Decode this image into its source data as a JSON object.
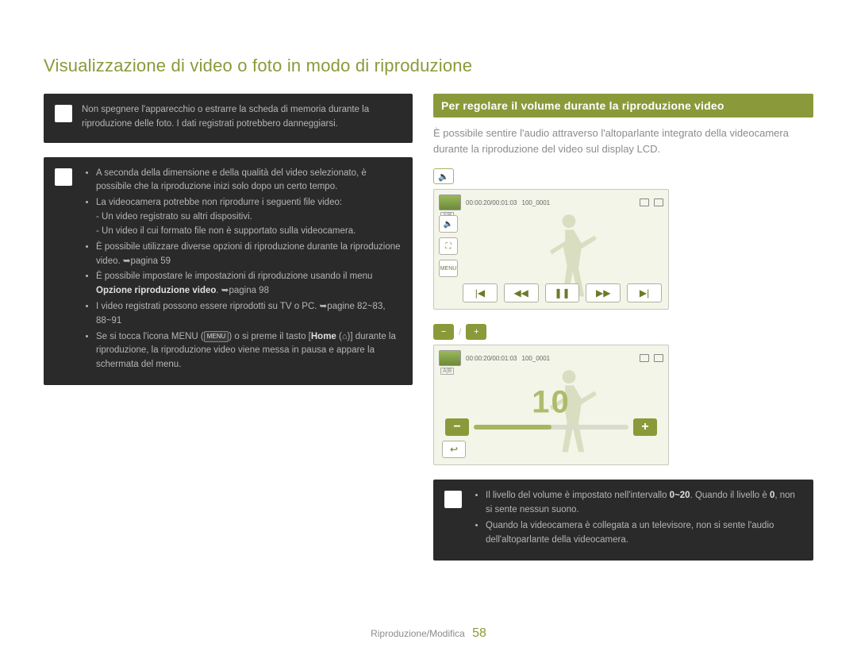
{
  "title": "Visualizzazione di video o foto in modo di riproduzione",
  "left": {
    "warn": "Non spegnere l'apparecchio o estrarre la scheda di memoria durante la riproduzione delle foto. I dati registrati potrebbero danneggiarsi.",
    "notes": {
      "i1": "A seconda della dimensione e della qualità del video selezionato, è possibile che la riproduzione inizi solo dopo un certo tempo.",
      "i2": "La videocamera potrebbe non riprodurre i seguenti file video:",
      "i2a": "- Un video registrato su altri dispositivi.",
      "i2b": "- Un video il cui formato file non è supportato sulla videocamera.",
      "i3": "È possibile utilizzare diverse opzioni di riproduzione durante la riproduzione video. ➥pagina 59",
      "i4a": "È possibile impostare le impostazioni di riproduzione usando il menu ",
      "i4b": "Opzione riproduzione video",
      "i4c": ". ➥pagina 98",
      "i5": "I video registrati possono essere riprodotti su TV o PC. ➥pagine 82~83, 88~91",
      "i6a": "Se si tocca l'icona MENU (",
      "i6b": ") o si preme il tasto [",
      "i6c": "Home",
      "i6d": " (",
      "i6e": ")] durante la riproduzione, la riproduzione video viene messa in pausa e appare la schermata del menu.",
      "menu_chip": "MENU",
      "home_chip": "⌂"
    }
  },
  "right": {
    "section": "Per regolare il volume durante la riproduzione video",
    "intro": "È possibile sentire l'audio attraverso l'altoparlante integrato della videocamera durante la riproduzione del video sul display LCD.",
    "step1_glyph": "🔈",
    "step2_minus": "−",
    "step2_plus": "+",
    "screen": {
      "time": "00:00:20/00:01:03",
      "clip": "100_0001",
      "ab": "A|B",
      "menu": "MENU",
      "vol_level": "10",
      "icons": {
        "speaker": "🔈",
        "expand": "⛶",
        "prev": "|◀",
        "rew": "◀◀",
        "pause": "❚❚",
        "ff": "▶▶",
        "next": "▶|",
        "back": "↩"
      }
    },
    "bottom_notes": {
      "n1a": "Il livello del volume è impostato nell'intervallo ",
      "n1b": "0~20",
      "n1c": ". Quando il livello è ",
      "n1d": "0",
      "n1e": ", non si sente nessun suono.",
      "n2": "Quando la videocamera è collegata a un televisore, non si sente l'audio dell'altoparlante della videocamera."
    }
  },
  "footer": {
    "section": "Riproduzione/Modifica",
    "page": "58"
  }
}
